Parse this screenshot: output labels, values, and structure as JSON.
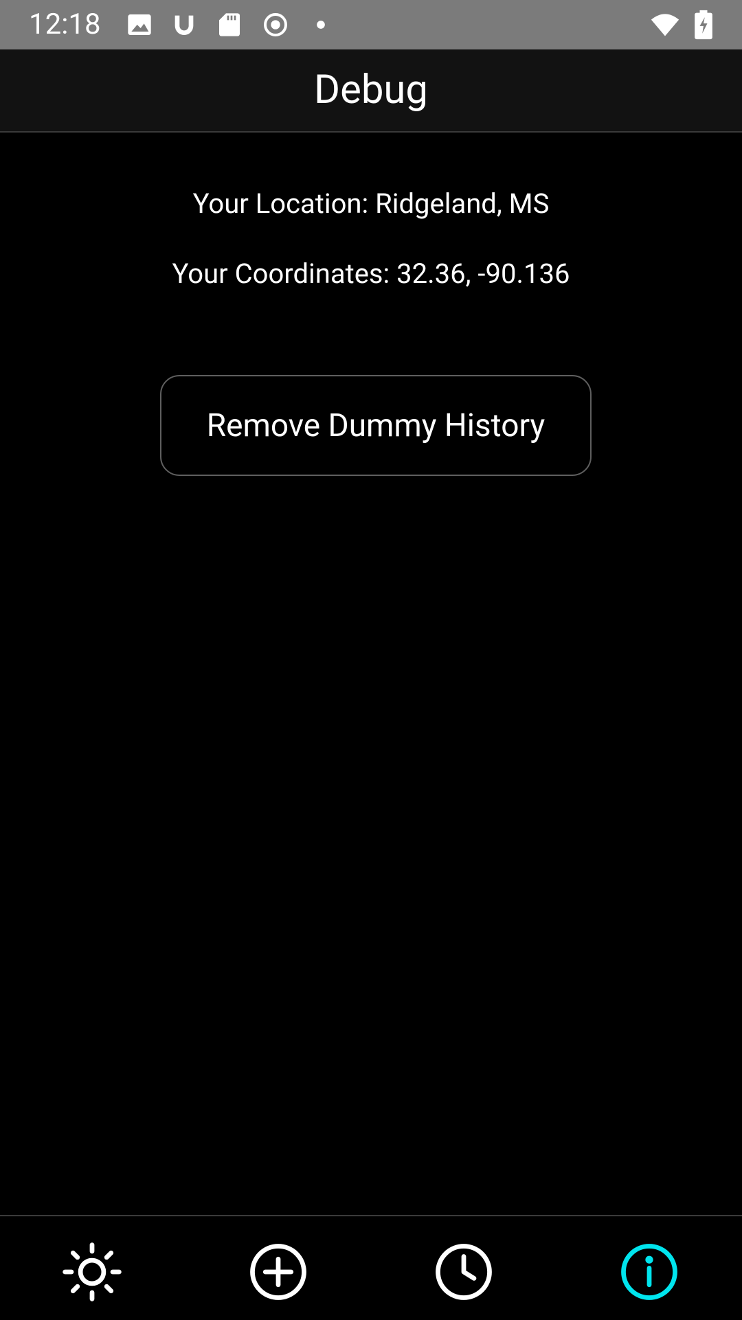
{
  "status_bar": {
    "time": "12:18",
    "icons": [
      "image-icon",
      "magnet-icon",
      "sd-card-icon",
      "record-icon",
      "dot-icon",
      "wifi-icon",
      "battery-charging-icon"
    ]
  },
  "app_bar": {
    "title": "Debug"
  },
  "main": {
    "location_text": "Your Location: Ridgeland, MS",
    "coordinates_text": "Your Coordinates: 32.36, -90.136",
    "remove_button_label": "Remove Dummy History"
  },
  "bottom_nav": {
    "items": [
      {
        "icon": "sun-icon",
        "active": false
      },
      {
        "icon": "add-circle-icon",
        "active": false
      },
      {
        "icon": "clock-icon",
        "active": false
      },
      {
        "icon": "info-icon",
        "active": true
      }
    ],
    "active_color": "#00e5ee",
    "inactive_color": "#ffffff"
  }
}
